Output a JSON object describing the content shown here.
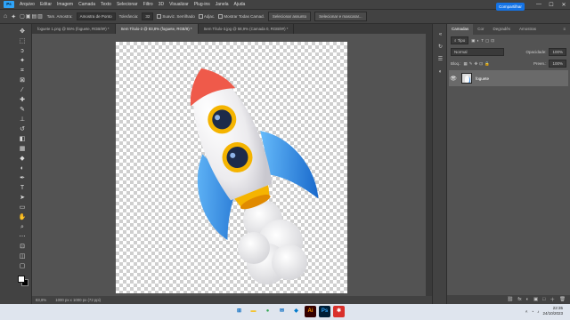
{
  "app": {
    "logo": "Ps"
  },
  "menus": [
    "Arquivo",
    "Editar",
    "Imagem",
    "Camada",
    "Texto",
    "Selecionar",
    "Filtro",
    "3D",
    "Visualizar",
    "Plug-ins",
    "Janela",
    "Ajuda"
  ],
  "window_controls": {
    "minimize": "—",
    "maximize": "☐",
    "close": "✕"
  },
  "options": {
    "size_label": "Tam. Amostra:",
    "sample_size": "Amostra de Ponto",
    "tolerance_label": "Tolerância:",
    "tolerance": "32",
    "antialias": "Suaviz. Serrilhado",
    "contiguous": "Adjac.",
    "sample_all": "Mostrar Todas Camad.",
    "select_subject": "Selecionar assunto",
    "select_mask": "Selecionar e mascarar...",
    "share": "Compartilhar"
  },
  "tabs": [
    {
      "label": "foguete 1.png @ 55% (foguete, RGB/8#) *",
      "active": false
    },
    {
      "label": "Sem Título-2 @ 83,8% (foguete, RGB/8) *",
      "active": true
    },
    {
      "label": "Sem Título-3.jpg @ 58,9% (Camada 0, RGB/8#) *",
      "active": false
    }
  ],
  "status": {
    "zoom": "83,8%",
    "doc": "1000 px x 1000 px (72 ppi)"
  },
  "panel": {
    "tabs": [
      {
        "label": "Camadas",
        "active": true
      },
      {
        "label": "Cor",
        "active": false
      },
      {
        "label": "Degradês",
        "active": false
      },
      {
        "label": "Amostras",
        "active": false
      }
    ],
    "filter_kind": "Tipo",
    "blend_mode": "Normal",
    "opacity_label": "Opacidade:",
    "opacity": "100%",
    "lock_label": "Bloq.:",
    "fill_label": "Preen.:",
    "fill": "100%",
    "layers": [
      {
        "name": "foguete",
        "visible": true,
        "selected": true
      }
    ],
    "bottom_icons": [
      "fx",
      "◐",
      "▣",
      "□",
      "＋",
      "🗑"
    ]
  },
  "taskbar": {
    "apps": [
      {
        "name": "windows",
        "glyph": "⊞",
        "color": "#0067c0",
        "bg": "#dfe5ee"
      },
      {
        "name": "explorer",
        "glyph": "▬",
        "color": "#f4c430",
        "bg": "#dfe5ee"
      },
      {
        "name": "chrome",
        "glyph": "●",
        "color": "#34a853",
        "bg": "#dfe5ee"
      },
      {
        "name": "mail",
        "glyph": "✉",
        "color": "#0067c0",
        "bg": "#dfe5ee"
      },
      {
        "name": "vscode",
        "glyph": "◆",
        "color": "#007acc",
        "bg": "#dfe5ee"
      },
      {
        "name": "illustrator",
        "glyph": "Ai",
        "color": "#ff9a00",
        "bg": "#330000"
      },
      {
        "name": "photoshop",
        "glyph": "Ps",
        "color": "#31a8ff",
        "bg": "#001e36"
      },
      {
        "name": "app-red",
        "glyph": "✱",
        "color": "#ffffff",
        "bg": "#d9302b"
      }
    ],
    "time": "22:35",
    "date": "24/10/2023"
  }
}
